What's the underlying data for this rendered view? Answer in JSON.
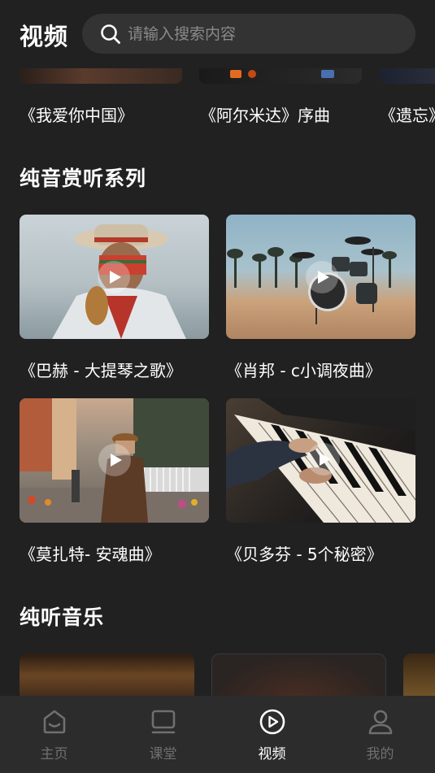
{
  "header": {
    "title": "视频",
    "search_placeholder": "请输入搜索内容"
  },
  "top_row": {
    "items": [
      {
        "title": "《我爱你中国》"
      },
      {
        "title": "《阿尔米达》序曲"
      },
      {
        "title": "《遗忘》"
      }
    ]
  },
  "sections": [
    {
      "title": "纯音赏听系列",
      "items": [
        {
          "title": "《巴赫 - 大提琴之歌》",
          "image": "pan-flute-player-photo"
        },
        {
          "title": "《肖邦 - c小调夜曲》",
          "image": "drum-kit-on-street-photo"
        },
        {
          "title": "《莫扎特- 安魂曲》",
          "image": "street-musician-photo"
        },
        {
          "title": "《贝多芬 - 5个秘密》",
          "image": "piano-hands-photo"
        }
      ]
    },
    {
      "title": "纯听音乐"
    }
  ],
  "tabbar": {
    "tabs": [
      {
        "label": "主页",
        "icon": "home-icon",
        "active": false
      },
      {
        "label": "课堂",
        "icon": "monitor-icon",
        "active": false
      },
      {
        "label": "视频",
        "icon": "play-circle-icon",
        "active": true
      },
      {
        "label": "我的",
        "icon": "user-icon",
        "active": false
      }
    ]
  },
  "colors": {
    "background": "#212121",
    "search_bg": "#333333",
    "tabbar_bg": "#2c2c2c",
    "active_tab": "#ffffff",
    "inactive_tab": "#6f6f6f"
  }
}
